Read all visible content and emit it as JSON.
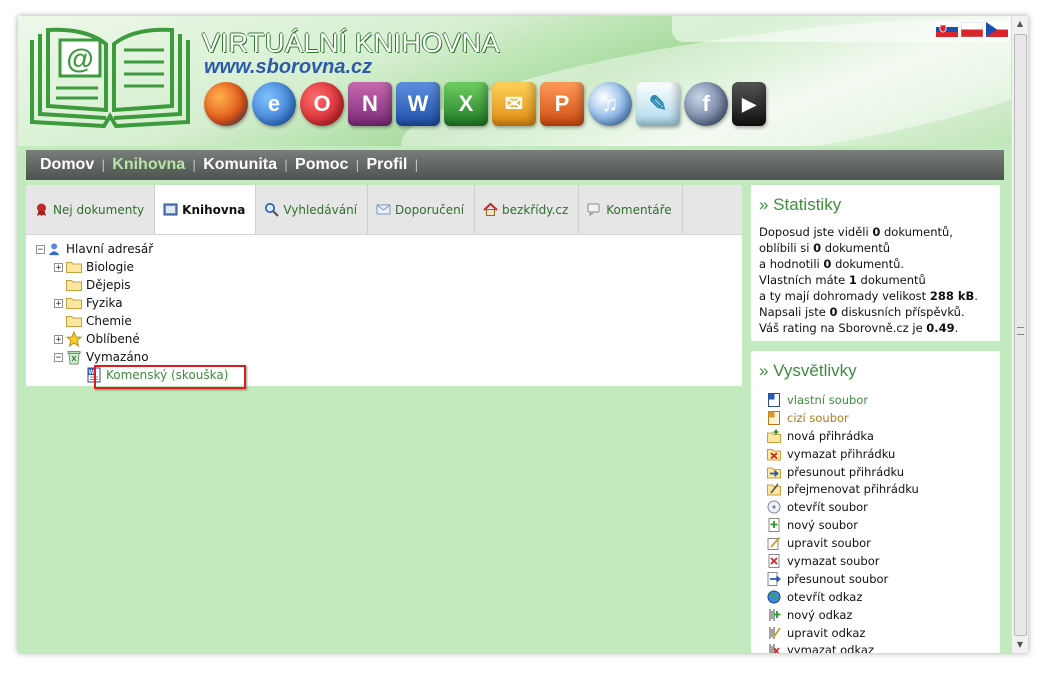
{
  "header": {
    "title": "VIRTUÁLNÍ KNIHOVNA",
    "url": "www.sborovna.cz",
    "flags": [
      "slovak-flag",
      "polish-flag",
      "czech-flag"
    ],
    "app_icons": [
      "firefox-icon",
      "internet-explorer-icon",
      "opera-icon",
      "onenote-icon",
      "word-icon",
      "excel-icon",
      "outlook-icon",
      "powerpoint-icon",
      "audio-cd-icon",
      "quill-document-icon",
      "flash-icon",
      "avi-video-icon"
    ]
  },
  "nav": {
    "items": [
      {
        "label": "Domov",
        "active": false
      },
      {
        "label": "Knihovna",
        "active": true
      },
      {
        "label": "Komunita",
        "active": false
      },
      {
        "label": "Pomoc",
        "active": false
      },
      {
        "label": "Profil",
        "active": false
      }
    ],
    "separator": "|"
  },
  "tabs": [
    {
      "label": "Nej dokumenty",
      "icon": "ribbon-icon",
      "active": false
    },
    {
      "label": "Knihovna",
      "icon": "library-icon",
      "active": true
    },
    {
      "label": "Vyhledávání",
      "icon": "magnifier-icon",
      "active": false
    },
    {
      "label": "Doporučení",
      "icon": "envelope-icon",
      "active": false
    },
    {
      "label": "bezkřídy.cz",
      "icon": "house-icon",
      "active": false
    },
    {
      "label": "Komentáře",
      "icon": "comment-icon",
      "active": false
    }
  ],
  "tree": {
    "root": "Hlavní adresář",
    "items": [
      {
        "label": "Biologie",
        "expandable": true
      },
      {
        "label": "Dějepis",
        "expandable": false
      },
      {
        "label": "Fyzika",
        "expandable": true
      },
      {
        "label": "Chemie",
        "expandable": false
      },
      {
        "label": "Oblíbené",
        "expandable": true
      },
      {
        "label": "Vymazáno",
        "expandable": true
      }
    ],
    "file": "Komenský (skouška)"
  },
  "statistics": {
    "title": "» Statistiky",
    "line1_a": "Doposud jste viděli ",
    "line1_b": "0",
    "line1_c": " dokumentů,",
    "line2_a": "oblíbili si ",
    "line2_b": "0",
    "line2_c": " dokumentů",
    "line3_a": "a hodnotili ",
    "line3_b": "0",
    "line3_c": " dokumentů.",
    "line4_a": "Vlastních máte ",
    "line4_b": "1",
    "line4_c": " dokumentů",
    "line5_a": "a ty mají dohromady velikost ",
    "line5_b": "288 kB",
    "line5_c": ".",
    "line6_a": "Napsali jste ",
    "line6_b": "0",
    "line6_c": " diskusních příspěvků.",
    "line7_a": "Váš rating na Sborovně.cz je ",
    "line7_b": "0.49",
    "line7_c": "."
  },
  "legend": {
    "title": "» Vysvětlivky",
    "items": [
      {
        "label": "vlastní soubor",
        "icon": "word-doc-icon",
        "color": "#3e8e3e"
      },
      {
        "label": "cizí soubor",
        "icon": "foreign-doc-icon",
        "color": "#b07a1a"
      },
      {
        "label": "nová přihrádka",
        "icon": "new-folder-icon",
        "color": "#111111"
      },
      {
        "label": "vymazat přihrádku",
        "icon": "delete-folder-icon",
        "color": "#111111"
      },
      {
        "label": "přesunout přihrádku",
        "icon": "move-folder-icon",
        "color": "#111111"
      },
      {
        "label": "přejmenovat přihrádku",
        "icon": "rename-folder-icon",
        "color": "#111111"
      },
      {
        "label": "otevřít soubor",
        "icon": "open-file-icon",
        "color": "#111111"
      },
      {
        "label": "nový soubor",
        "icon": "new-file-icon",
        "color": "#111111"
      },
      {
        "label": "upravit soubor",
        "icon": "edit-file-icon",
        "color": "#111111"
      },
      {
        "label": "vymazat soubor",
        "icon": "delete-file-icon",
        "color": "#111111"
      },
      {
        "label": "přesunout soubor",
        "icon": "move-file-icon",
        "color": "#111111"
      },
      {
        "label": "otevřít odkaz",
        "icon": "globe-icon",
        "color": "#111111"
      },
      {
        "label": "nový odkaz",
        "icon": "new-link-icon",
        "color": "#111111"
      },
      {
        "label": "upravit odkaz",
        "icon": "edit-link-icon",
        "color": "#111111"
      },
      {
        "label": "vymazat odkaz",
        "icon": "delete-link-icon",
        "color": "#111111"
      }
    ]
  },
  "colors": {
    "page_bg": "#c3e9bf",
    "accent_green": "#3e8e3e",
    "nav_bg": "#5f635f",
    "highlight_red": "#e11a1a"
  }
}
